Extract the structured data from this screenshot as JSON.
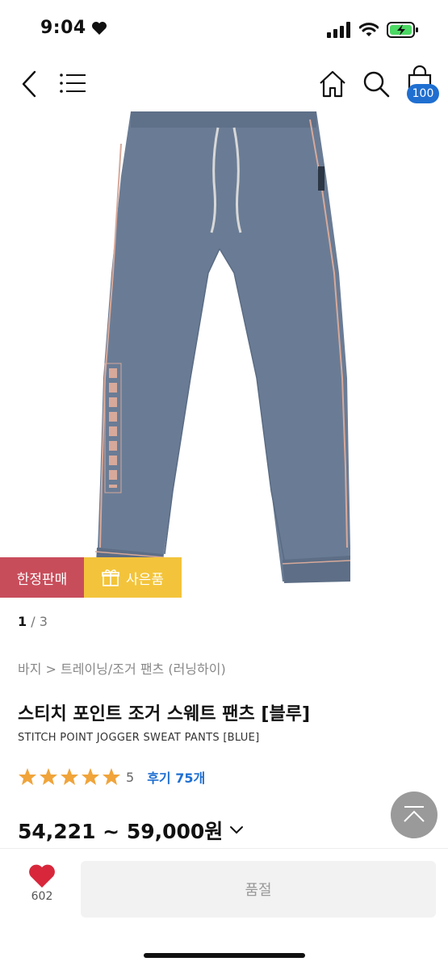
{
  "status": {
    "time": "9:04"
  },
  "cart": {
    "count": "100"
  },
  "badges": {
    "limited": "한정판매",
    "gift": "사은품"
  },
  "pager": {
    "current": "1",
    "separator": "/",
    "total": "3"
  },
  "breadcrumb": "바지 > 트레이닝/조거 팬츠 (러닝하이)",
  "product": {
    "title_ko": "스티치 포인트 조거 스웨트 팬츠 [블루]",
    "title_en": "STITCH POINT JOGGER SWEAT PANTS [BLUE]",
    "rating_score": "5",
    "reviews": "후기 75개",
    "price": "54,221 ~ 59,000원"
  },
  "bottom": {
    "like_count": "602",
    "soldout": "품절"
  },
  "colors": {
    "accent_blue": "#1f6fd1",
    "limited_red": "#c84d5b",
    "gift_yellow": "#f3c43b",
    "star": "#f0a43a",
    "heart": "#d8273b"
  }
}
